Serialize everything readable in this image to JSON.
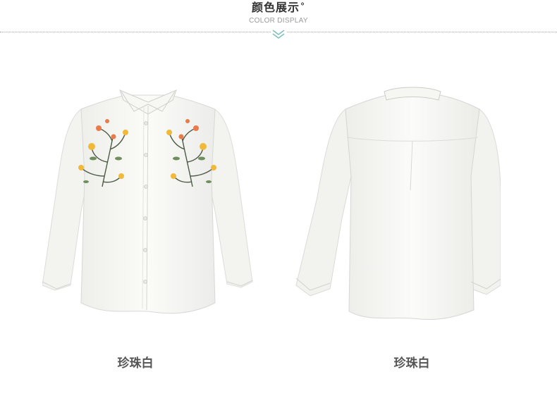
{
  "header": {
    "title": "颜色展示",
    "title_mark": "°",
    "subtitle": "COLOR DISPLAY",
    "chevron_icon": "double-chevron-down-icon",
    "accent_color": "#7fc1bb"
  },
  "products": [
    {
      "view": "front",
      "color_label": "珍珠白"
    },
    {
      "view": "back",
      "color_label": "珍珠白"
    }
  ]
}
